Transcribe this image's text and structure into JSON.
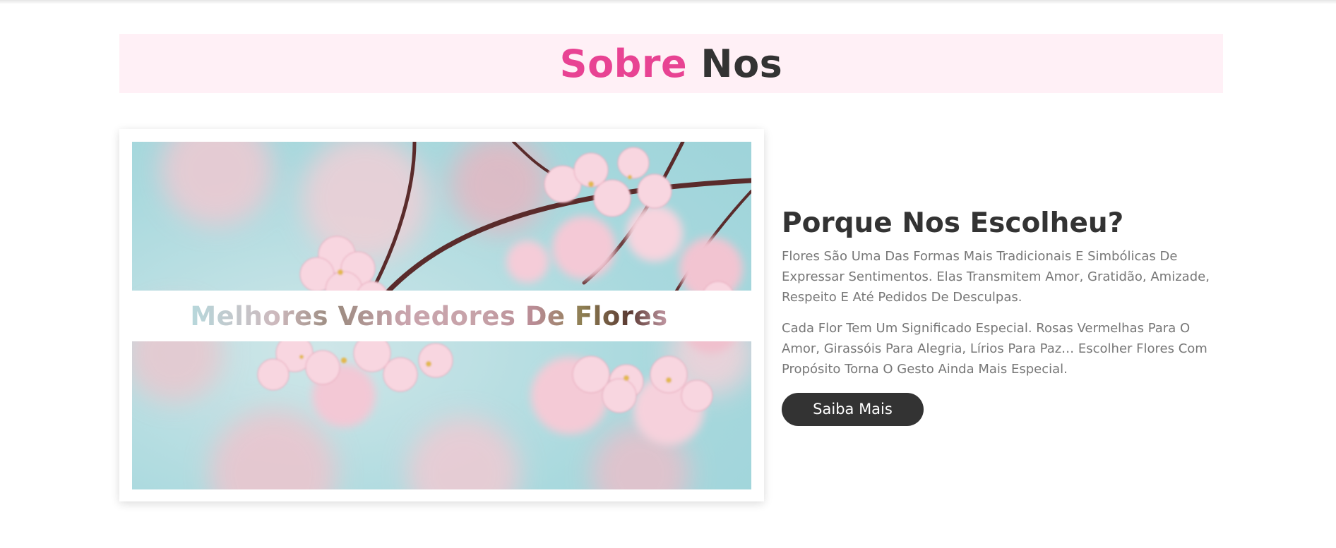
{
  "section": {
    "title_accent": "Sobre",
    "title_rest": "Nos"
  },
  "image": {
    "overlay_title": "Melhores Vendedores De Flores",
    "alt": "cherry blossom photo"
  },
  "content": {
    "heading": "Porque Nos Escolheu?",
    "paragraph_1": "Flores São Uma Das Formas Mais Tradicionais E Simbólicas De Expressar Sentimentos. Elas Transmitem Amor, Gratidão, Amizade, Respeito E Até Pedidos De Desculpas.",
    "paragraph_2": "Cada Flor Tem Um Significado Especial. Rosas Vermelhas Para O Amor, Girassóis Para Alegria, Lírios Para Paz… Escolher Flores Com Propósito Torna O Gesto Ainda Mais Especial.",
    "button_label": "Saiba Mais"
  },
  "colors": {
    "accent": "#e84393",
    "dark": "#333333",
    "heading_bg": "#fff0f6",
    "body_text": "#777777"
  }
}
